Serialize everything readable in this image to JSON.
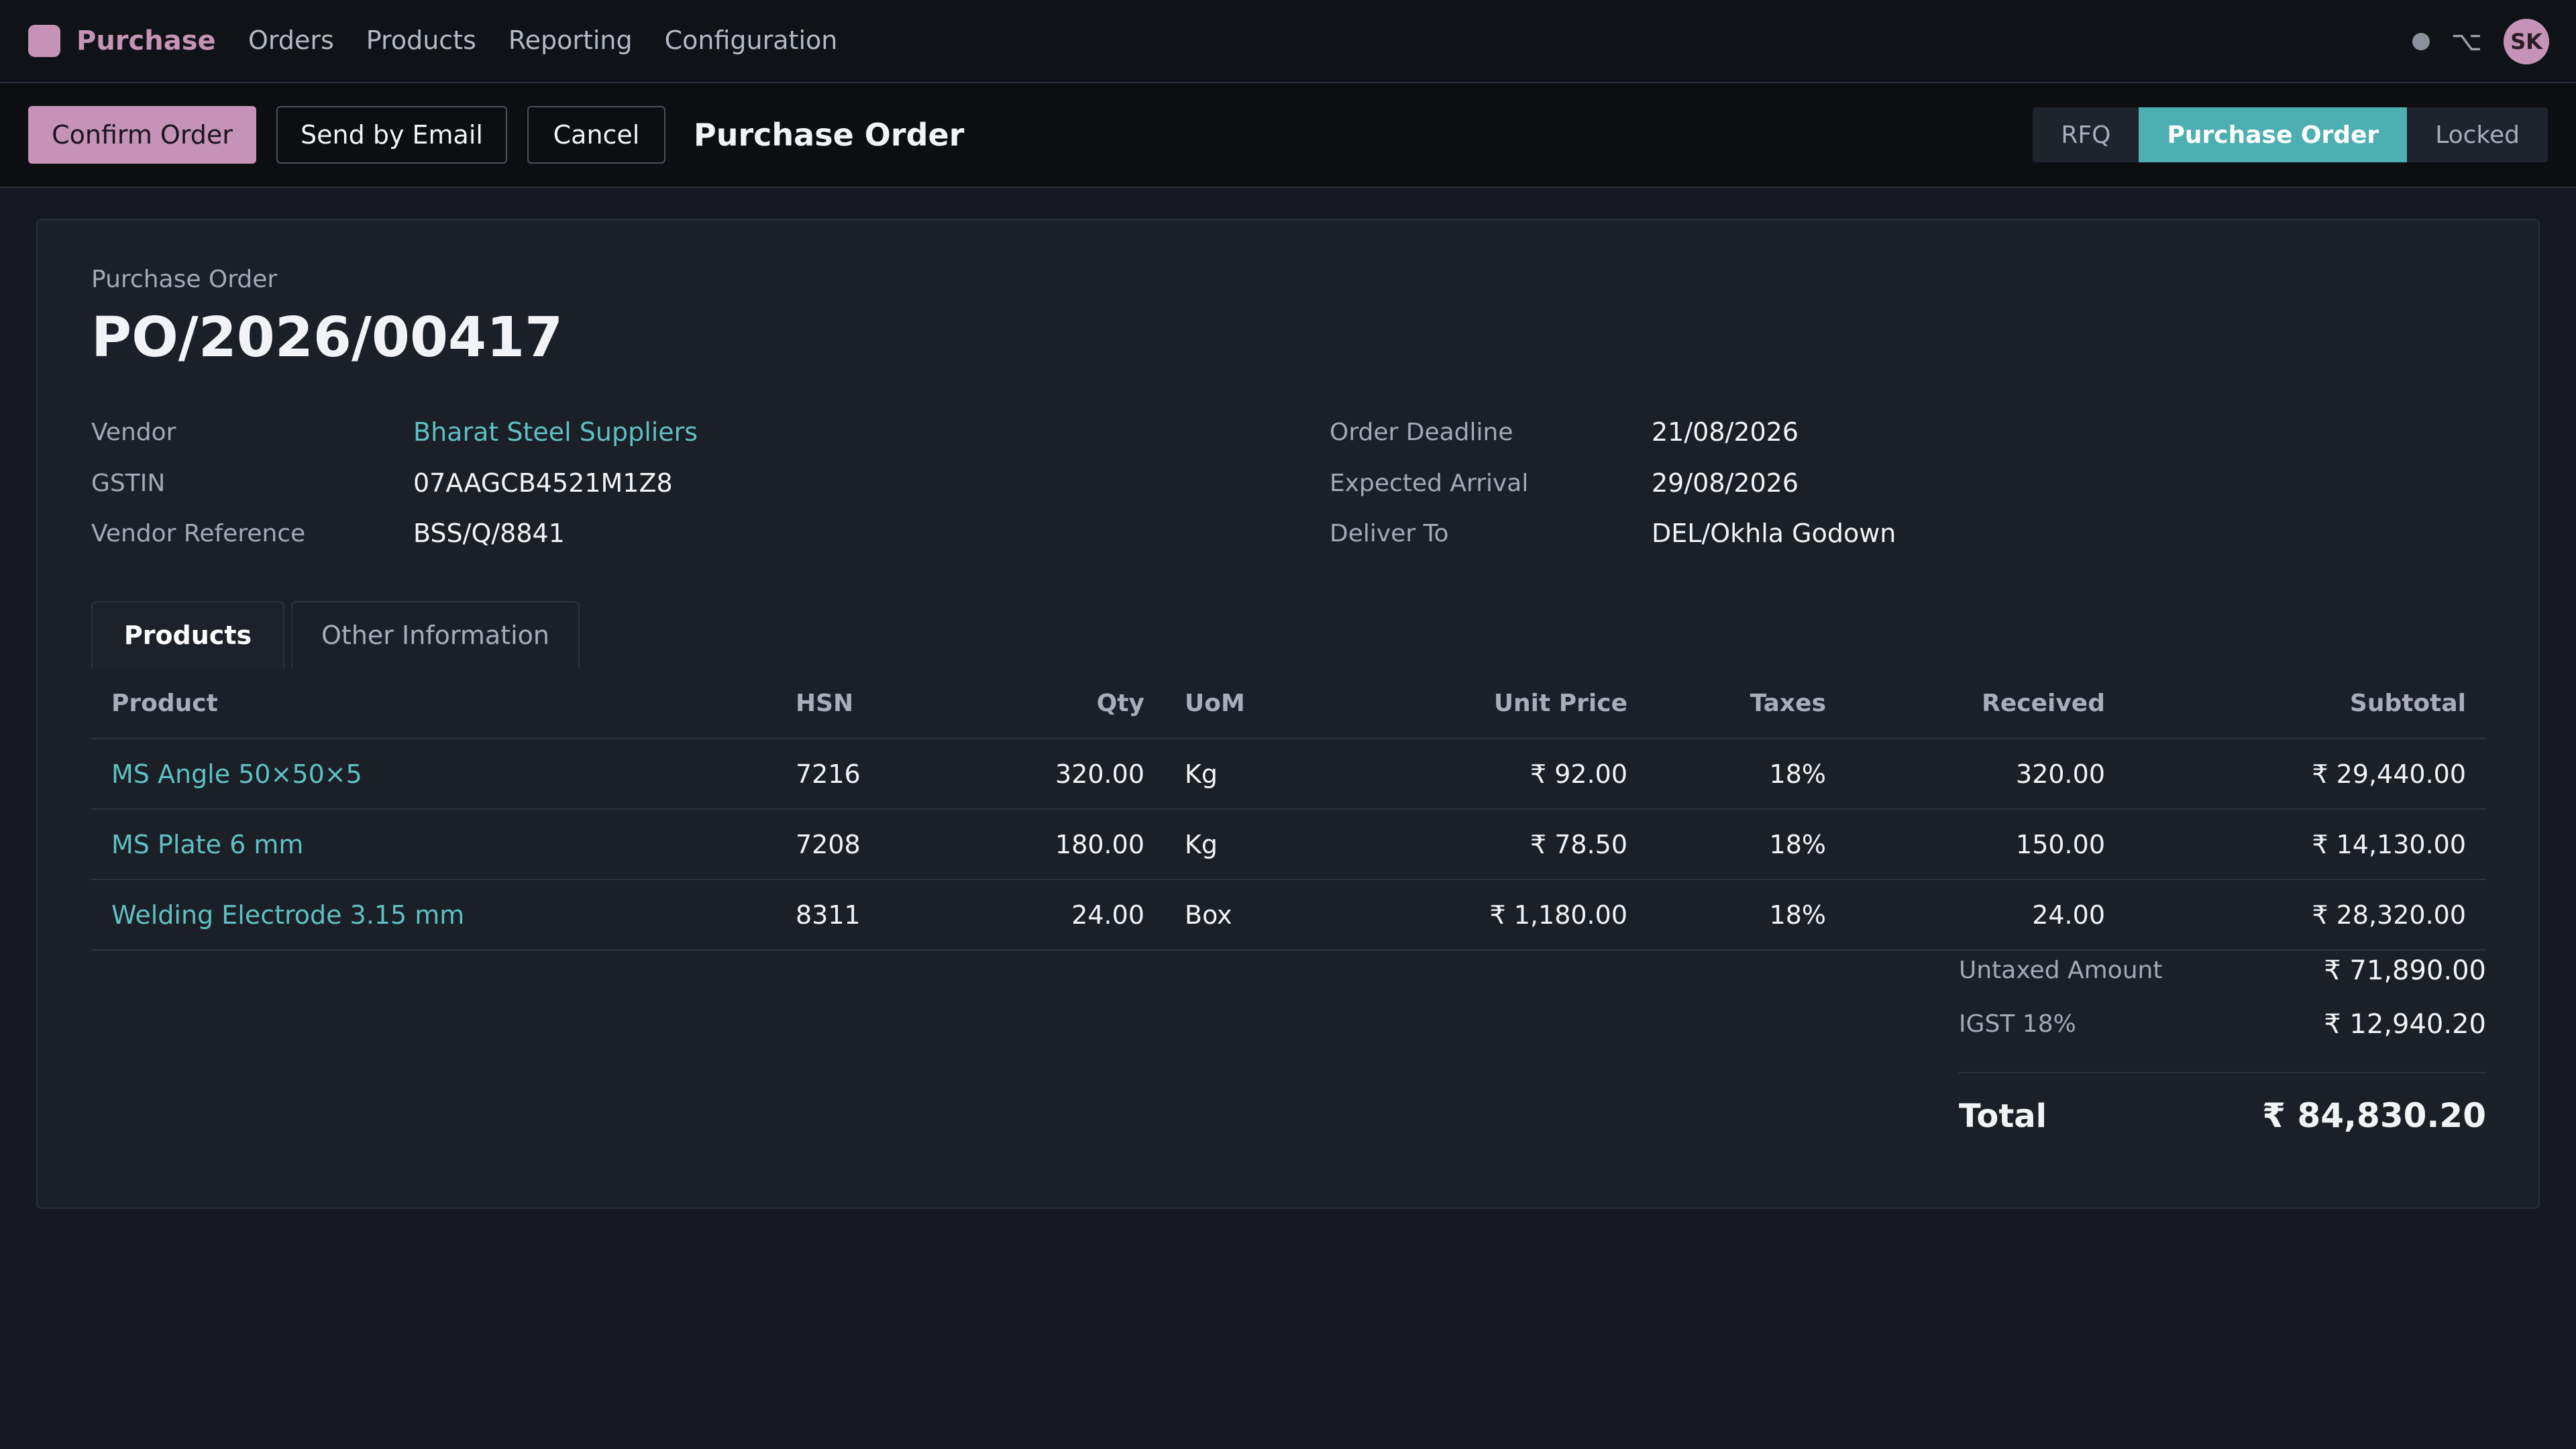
{
  "app": {
    "name": "Purchase",
    "nav": [
      "Orders",
      "Products",
      "Reporting",
      "Configuration"
    ],
    "user_initials": "SK",
    "debug_icon": "⌥"
  },
  "actions": {
    "confirm": "Confirm Order",
    "email": "Send by Email",
    "cancel": "Cancel",
    "title": "Purchase Order"
  },
  "statusbar": {
    "stages": [
      "RFQ",
      "Purchase Order",
      "Locked"
    ],
    "active": "Purchase Order"
  },
  "record": {
    "label": "Purchase Order",
    "number": "PO/2026/00417",
    "left_fields": [
      {
        "label": "Vendor",
        "value": "Bharat Steel Suppliers"
      },
      {
        "label": "GSTIN",
        "value": "07AAGCB4521M1Z8"
      },
      {
        "label": "Vendor Reference",
        "value": "BSS/Q/8841"
      }
    ],
    "right_fields": [
      {
        "label": "Order Deadline",
        "value": "21/08/2026"
      },
      {
        "label": "Expected Arrival",
        "value": "29/08/2026"
      },
      {
        "label": "Deliver To",
        "value": "DEL/Okhla Godown"
      }
    ]
  },
  "tabs": [
    "Products",
    "Other Information"
  ],
  "table": {
    "headers": [
      "Product",
      "HSN",
      "Qty",
      "UoM",
      "Unit Price",
      "Taxes",
      "Received",
      "Subtotal"
    ],
    "rows": [
      [
        "MS Angle 50×50×5",
        "7216",
        "320.00",
        "Kg",
        "₹ 92.00",
        "18%",
        "320.00",
        "₹ 29,440.00"
      ],
      [
        "MS Plate 6 mm",
        "7208",
        "180.00",
        "Kg",
        "₹ 78.50",
        "18%",
        "150.00",
        "₹ 14,130.00"
      ],
      [
        "Welding Electrode 3.15 mm",
        "8311",
        "24.00",
        "Box",
        "₹ 1,180.00",
        "18%",
        "24.00",
        "₹ 28,320.00"
      ]
    ]
  },
  "totals": {
    "untaxed_label": "Untaxed Amount",
    "untaxed_value": "₹ 71,890.00",
    "tax_label": "IGST 18%",
    "tax_value": "₹ 12,940.20",
    "total_label": "Total",
    "total_value": "₹ 84,830.20"
  },
  "colors": {
    "brand": "#c493b7",
    "accent": "#4eafb3",
    "link": "#5fc0c3",
    "background": "#151820"
  }
}
